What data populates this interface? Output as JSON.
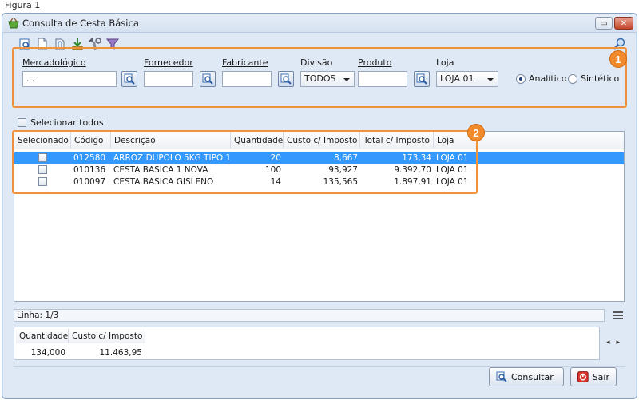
{
  "caption": "Figura 1",
  "window": {
    "title": "Consulta de Cesta Básica",
    "min_label": "▭",
    "close_label": "✕"
  },
  "toolbar": {
    "icons": [
      "preview-icon",
      "document-icon",
      "attach-icon",
      "download-icon",
      "tools-icon",
      "filter-icon"
    ],
    "search_icon": "magnifier-icon"
  },
  "badges": {
    "filters": "1",
    "grid": "2"
  },
  "filters": {
    "mercadologico": {
      "label": "Mercadológico",
      "value": " .  ."
    },
    "fornecedor": {
      "label": "Fornecedor",
      "value": ""
    },
    "fabricante": {
      "label": "Fabricante",
      "value": ""
    },
    "divisao": {
      "label": "Divisão",
      "selected": "TODOS"
    },
    "produto": {
      "label": "Produto",
      "value": ""
    },
    "loja": {
      "label": "Loja",
      "selected": "LOJA 01"
    },
    "analitico": "Analítico",
    "sintetico": "Sintético"
  },
  "select_all": "Selecionar todos",
  "grid": {
    "columns": [
      "Selecionado",
      "Código",
      "Descrição",
      "Quantidade",
      "Custo c/ Imposto",
      "Total c/ Imposto",
      "Loja"
    ],
    "rows": [
      {
        "codigo": "012580",
        "descricao": "ARROZ DUPOLO 5KG TIPO 1",
        "quantidade": "20",
        "custo": "8,667",
        "total": "173,34",
        "loja": "LOJA 01"
      },
      {
        "codigo": "010136",
        "descricao": "CESTA BASICA 1 NOVA",
        "quantidade": "100",
        "custo": "93,927",
        "total": "9.392,70",
        "loja": "LOJA 01"
      },
      {
        "codigo": "010097",
        "descricao": "CESTA BASICA GISLENO",
        "quantidade": "14",
        "custo": "135,565",
        "total": "1.897,91",
        "loja": "LOJA 01"
      }
    ]
  },
  "status": {
    "linha": "Linha: 1/3"
  },
  "summary": {
    "headers": [
      "Quantidade",
      "Custo c/ Imposto"
    ],
    "quantidade": "134,000",
    "custo": "11.463,95"
  },
  "buttons": {
    "consultar": "Consultar",
    "sair": "Sair"
  },
  "colors": {
    "accent_orange": "#f0913b",
    "selection_blue": "#3399ff"
  }
}
